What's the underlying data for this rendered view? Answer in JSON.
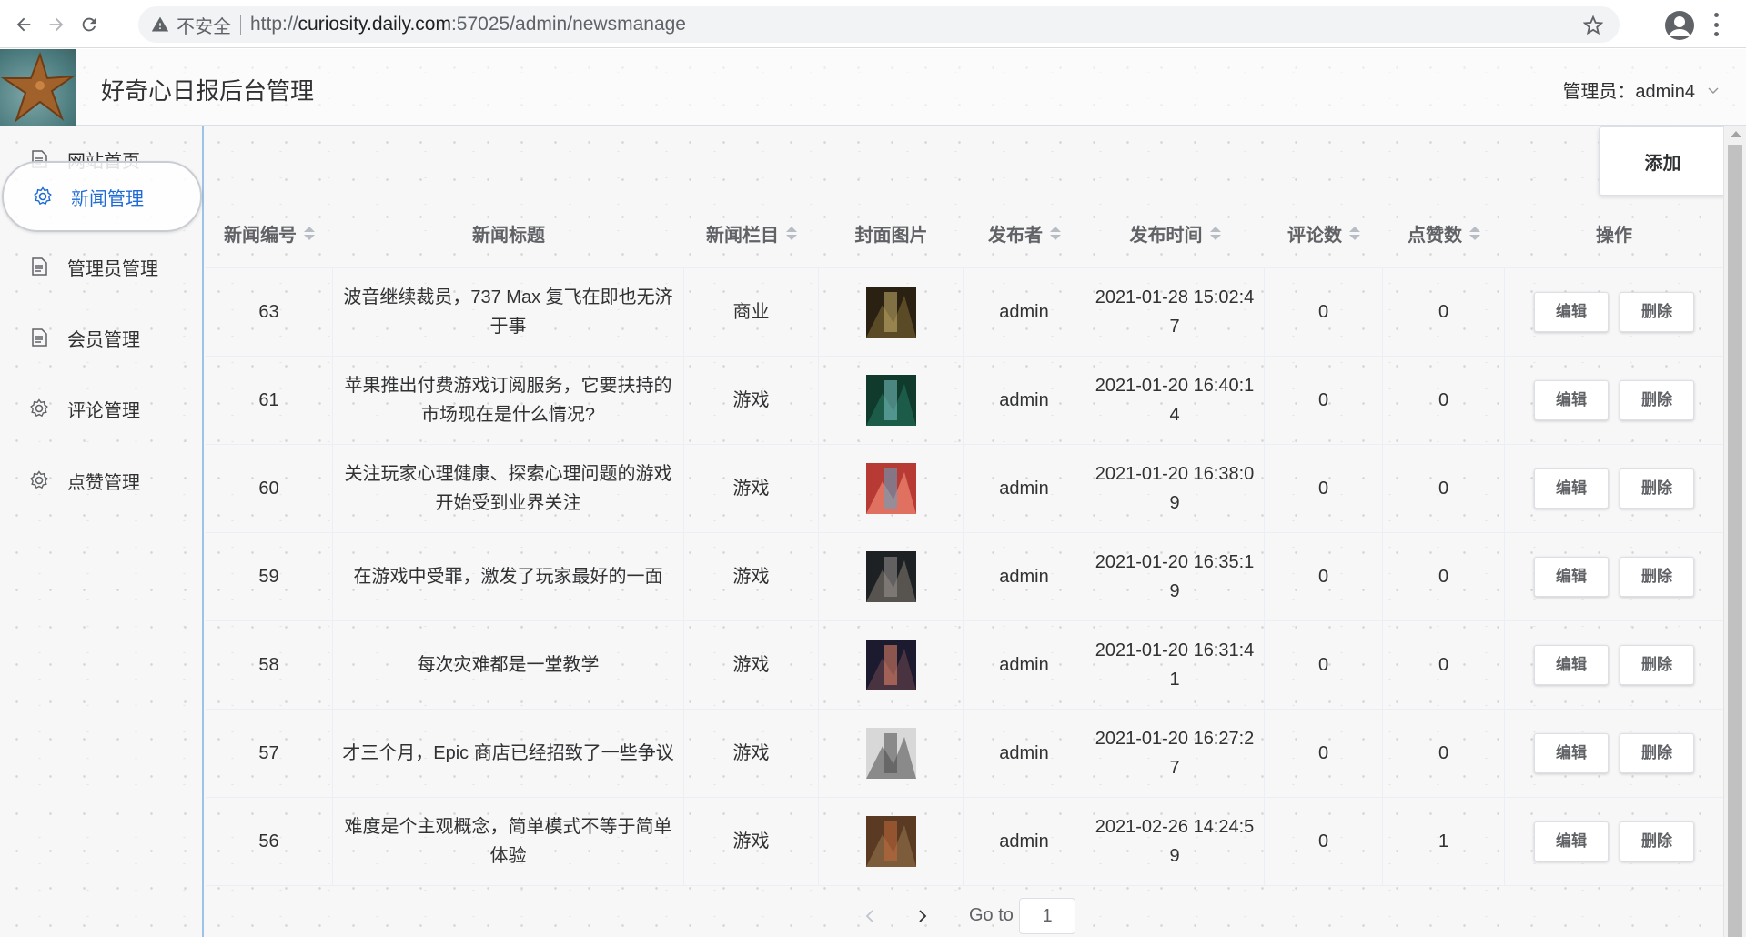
{
  "browser": {
    "insecure_label": "不安全",
    "url_prefix": "http://",
    "url_host": "curiosity.daily.com",
    "url_rest": ":57025/admin/newsmanage"
  },
  "header": {
    "title": "好奇心日报后台管理",
    "user_label": "管理员：admin4"
  },
  "sidebar": {
    "items": [
      {
        "label": "网站首页",
        "icon": "document-icon"
      },
      {
        "label": "新闻管理",
        "icon": "gear-icon"
      },
      {
        "label": "管理员管理",
        "icon": "document-icon"
      },
      {
        "label": "会员管理",
        "icon": "document-icon"
      },
      {
        "label": "评论管理",
        "icon": "gear-icon"
      },
      {
        "label": "点赞管理",
        "icon": "gear-icon"
      }
    ],
    "active_index": 1
  },
  "toolbar": {
    "add_label": "添加"
  },
  "table": {
    "headers": [
      "新闻编号",
      "新闻标题",
      "新闻栏目",
      "封面图片",
      "发布者",
      "发布时间",
      "评论数",
      "点赞数",
      "操作"
    ],
    "edit_label": "编辑",
    "delete_label": "删除",
    "rows": [
      {
        "id": "63",
        "title": "波音继续裁员，737 Max 复飞在即也无济于事",
        "category": "商业",
        "publisher": "admin",
        "time": "2021-01-28 15:02:47",
        "comments": "0",
        "likes": "0",
        "cover_colors": [
          "#2a2113",
          "#c9b26d",
          "#5a4a26"
        ]
      },
      {
        "id": "61",
        "title": "苹果推出付费游戏订阅服务，它要扶持的市场现在是什么情况?",
        "category": "游戏",
        "publisher": "admin",
        "time": "2021-01-20 16:40:14",
        "comments": "0",
        "likes": "0",
        "cover_colors": [
          "#0f3a2c",
          "#7fc4c9",
          "#1b5b47"
        ]
      },
      {
        "id": "60",
        "title": "关注玩家心理健康、探索心理问题的游戏开始受到业界关注",
        "category": "游戏",
        "publisher": "admin",
        "time": "2021-01-20 16:38:09",
        "comments": "0",
        "likes": "0",
        "cover_colors": [
          "#b83a35",
          "#5ba6c7",
          "#e07060"
        ]
      },
      {
        "id": "59",
        "title": "在游戏中受罪，激发了玩家最好的一面",
        "category": "游戏",
        "publisher": "admin",
        "time": "2021-01-20 16:35:19",
        "comments": "0",
        "likes": "0",
        "cover_colors": [
          "#1e2124",
          "#9a9691",
          "#57534e"
        ]
      },
      {
        "id": "58",
        "title": "每次灾难都是一堂教学",
        "category": "游戏",
        "publisher": "admin",
        "time": "2021-01-20 16:31:41",
        "comments": "0",
        "likes": "0",
        "cover_colors": [
          "#1b1a2e",
          "#e9866a",
          "#4a3340"
        ]
      },
      {
        "id": "57",
        "title": "才三个月，Epic 商店已经招致了一些争议",
        "category": "游戏",
        "publisher": "admin",
        "time": "2021-01-20 16:27:27",
        "comments": "0",
        "likes": "0",
        "cover_colors": [
          "#d8d8d8",
          "#4a4a4a",
          "#8a8a8a"
        ]
      },
      {
        "id": "56",
        "title": "难度是个主观概念，简单模式不等于简单体验",
        "category": "游戏",
        "publisher": "admin",
        "time": "2021-02-26 14:24:59",
        "comments": "0",
        "likes": "1",
        "cover_colors": [
          "#5a3a22",
          "#c56a3a",
          "#7d5c3c"
        ]
      }
    ]
  },
  "pagination": {
    "goto_label": "Go to",
    "current_page": "1"
  }
}
